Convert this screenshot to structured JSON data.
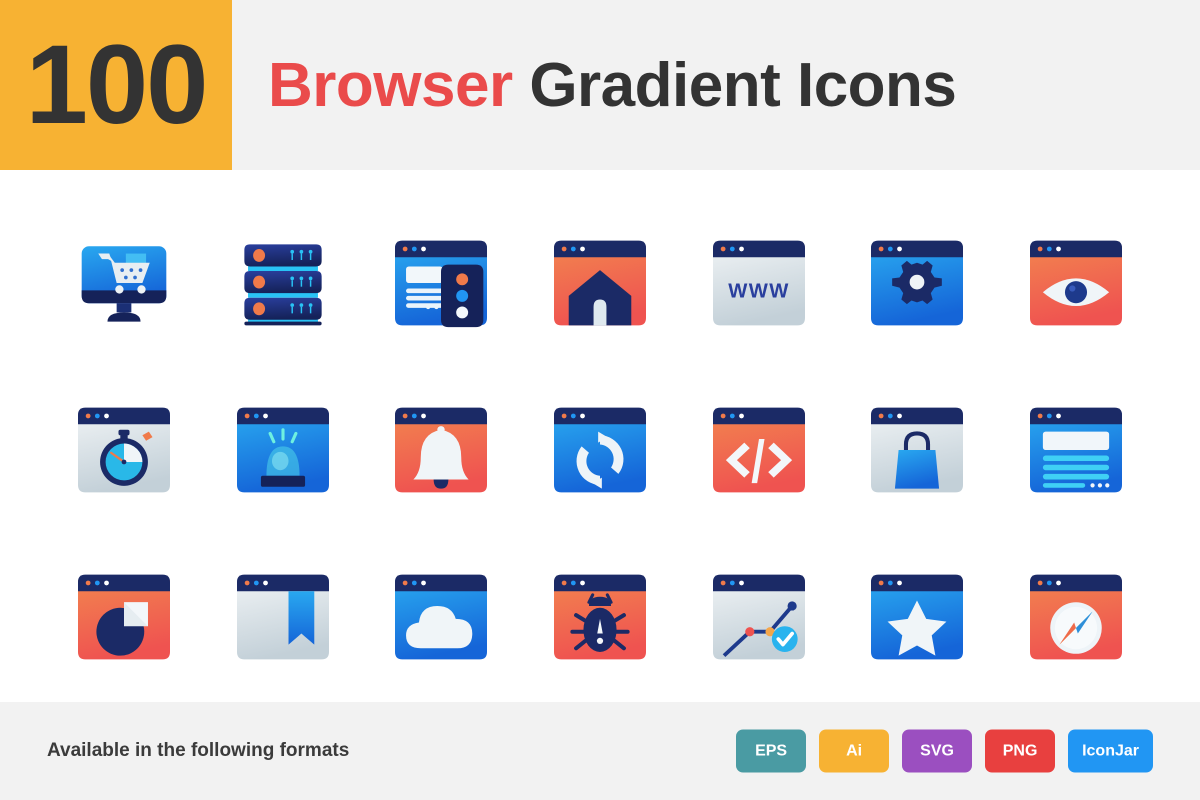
{
  "header": {
    "count": "100",
    "title_accent": "Browser",
    "title_rest": " Gradient Icons",
    "count_box_color": "#f7b233",
    "accent_color": "#ea4b4b",
    "text_color": "#333333",
    "band_color": "#f2f2f2"
  },
  "icons": [
    {
      "name": "ecommerce-monitor-icon",
      "label": "Online Shopping Monitor",
      "theme": "blue",
      "glyph": "monitor-cart"
    },
    {
      "name": "server-stack-icon",
      "label": "Server Stack",
      "theme": "blue",
      "glyph": "server"
    },
    {
      "name": "browser-traffic-light-icon",
      "label": "Web Page Traffic Light",
      "theme": "blue",
      "glyph": "page-traffic"
    },
    {
      "name": "home-page-icon",
      "label": "Home Page",
      "theme": "orange",
      "glyph": "home"
    },
    {
      "name": "www-icon",
      "label": "WWW Website",
      "theme": "silver",
      "glyph": "www",
      "text": "WWW"
    },
    {
      "name": "browser-settings-icon",
      "label": "Browser Settings",
      "theme": "blue",
      "glyph": "gear"
    },
    {
      "name": "page-view-icon",
      "label": "Page Views",
      "theme": "orange",
      "glyph": "eye"
    },
    {
      "name": "page-speed-icon",
      "label": "Page Load Speed",
      "theme": "silver",
      "glyph": "stopwatch"
    },
    {
      "name": "browser-alert-icon",
      "label": "Browser Alarm",
      "theme": "blue",
      "glyph": "siren"
    },
    {
      "name": "notification-bell-icon",
      "label": "Notification",
      "theme": "orange",
      "glyph": "bell"
    },
    {
      "name": "refresh-sync-icon",
      "label": "Refresh Page",
      "theme": "blue",
      "glyph": "refresh"
    },
    {
      "name": "source-code-icon",
      "label": "Source Code",
      "theme": "orange",
      "glyph": "code"
    },
    {
      "name": "shopping-bag-icon",
      "label": "Online Store",
      "theme": "silver",
      "glyph": "bag"
    },
    {
      "name": "article-content-icon",
      "label": "Page Content",
      "theme": "blue",
      "glyph": "content"
    },
    {
      "name": "pie-chart-icon",
      "label": "Web Analytics Pie",
      "theme": "orange",
      "glyph": "pie"
    },
    {
      "name": "bookmark-icon",
      "label": "Bookmark Page",
      "theme": "silver",
      "glyph": "bookmark"
    },
    {
      "name": "cloud-icon",
      "label": "Cloud Hosting",
      "theme": "blue",
      "glyph": "cloud"
    },
    {
      "name": "malware-bug-icon",
      "label": "Browser Malware",
      "theme": "orange",
      "glyph": "bug"
    },
    {
      "name": "analytics-graph-icon",
      "label": "Traffic Analytics",
      "theme": "silver",
      "glyph": "graph"
    },
    {
      "name": "favorite-star-icon",
      "label": "Favorite Page",
      "theme": "blue",
      "glyph": "star"
    },
    {
      "name": "compass-browser-icon",
      "label": "Web Browser Compass",
      "theme": "orange",
      "glyph": "compass"
    }
  ],
  "footer": {
    "label": "Available in the following formats",
    "band_color": "#f2f2f2",
    "badges": [
      {
        "name": "badge-eps",
        "label": "EPS",
        "color": "#4a9ba3"
      },
      {
        "name": "badge-ai",
        "label": "Ai",
        "color": "#f7b233"
      },
      {
        "name": "badge-svg",
        "label": "SVG",
        "color": "#9b4fc0"
      },
      {
        "name": "badge-png",
        "label": "PNG",
        "color": "#e8403f"
      },
      {
        "name": "badge-iconjar",
        "label": "IconJar",
        "color": "#2196f3"
      }
    ]
  },
  "palette": {
    "navy": "#1b2a66",
    "deep_navy": "#152259",
    "blue_light": "#29a8f0",
    "blue_dark": "#1565d8",
    "orange_light": "#f2834f",
    "orange_dark": "#ef5350",
    "silver_light": "#eef2f4",
    "silver_dark": "#c3d0d8",
    "dot_orange": "#f07a4a",
    "dot_blue": "#2196f3",
    "dot_white": "#ffffff"
  }
}
